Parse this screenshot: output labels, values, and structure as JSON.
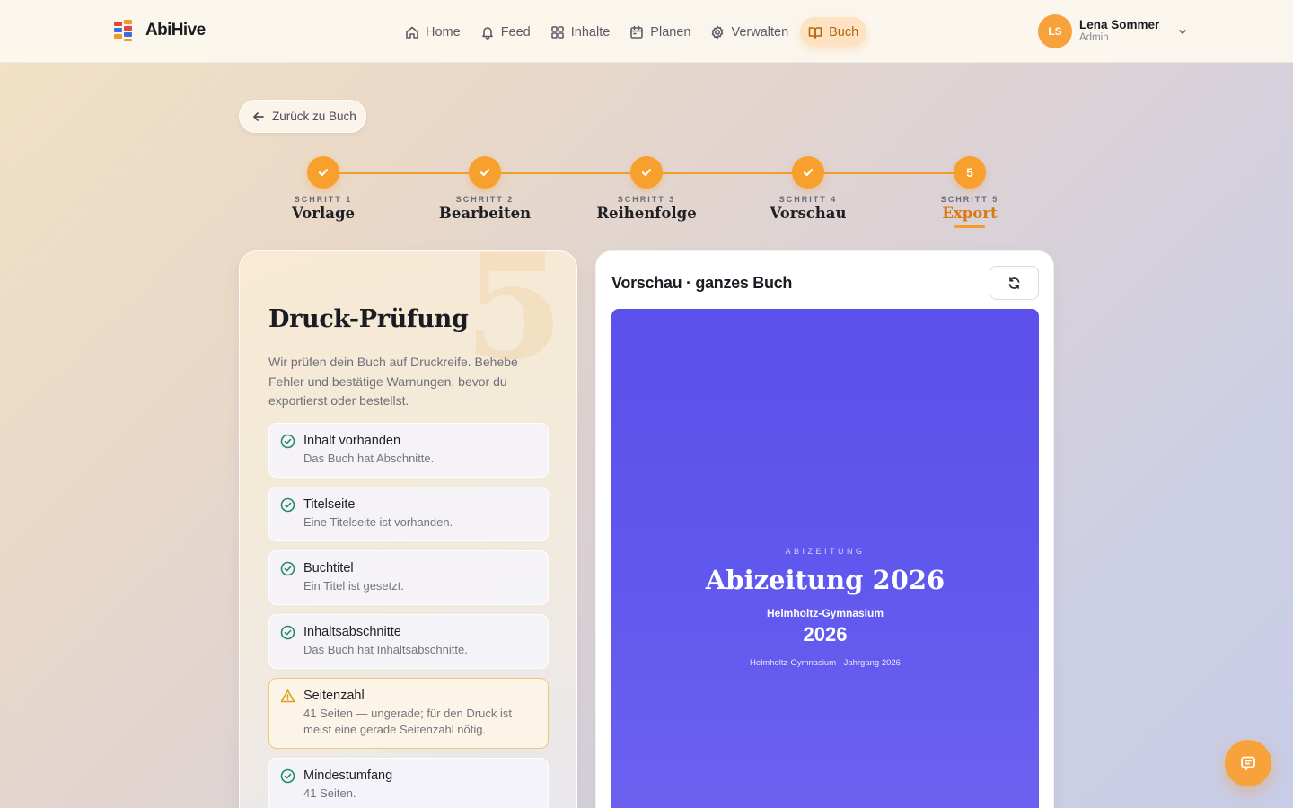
{
  "app": {
    "name": "AbiHive",
    "logo_icon": "abihive-logo-icon"
  },
  "nav": {
    "items": [
      {
        "label": "Home",
        "icon": "home-icon",
        "active": false
      },
      {
        "label": "Feed",
        "icon": "bell-icon",
        "active": false
      },
      {
        "label": "Inhalte",
        "icon": "grid-icon",
        "active": false
      },
      {
        "label": "Planen",
        "icon": "calendar-icon",
        "active": false
      },
      {
        "label": "Verwalten",
        "icon": "gear-icon",
        "active": false
      },
      {
        "label": "Buch",
        "icon": "book-icon",
        "active": true
      }
    ]
  },
  "user": {
    "initials": "LS",
    "name": "Lena Sommer",
    "role": "Admin"
  },
  "back_button": {
    "label": "Zurück zu Buch"
  },
  "stepper": {
    "steps": [
      {
        "kicker": "SCHRITT 1",
        "name": "Vorlage",
        "state": "done"
      },
      {
        "kicker": "SCHRITT 2",
        "name": "Bearbeiten",
        "state": "done"
      },
      {
        "kicker": "SCHRITT 3",
        "name": "Reihenfolge",
        "state": "done"
      },
      {
        "kicker": "SCHRITT 4",
        "name": "Vorschau",
        "state": "done"
      },
      {
        "kicker": "SCHRITT 5",
        "name": "Export",
        "number": "5",
        "state": "current"
      }
    ]
  },
  "check_panel": {
    "background_number": "5",
    "title": "Druck-Prüfung",
    "intro": "Wir prüfen dein Buch auf Druckreife. Behebe Fehler und bestätige Warnungen, bevor du exportierst oder bestellst.",
    "checks": [
      {
        "title": "Inhalt vorhanden",
        "description": "Das Buch hat Abschnitte.",
        "status": "ok"
      },
      {
        "title": "Titelseite",
        "description": "Eine Titelseite ist vorhanden.",
        "status": "ok"
      },
      {
        "title": "Buchtitel",
        "description": "Ein Titel ist gesetzt.",
        "status": "ok"
      },
      {
        "title": "Inhaltsabschnitte",
        "description": "Das Buch hat Inhaltsabschnitte.",
        "status": "ok"
      },
      {
        "title": "Seitenzahl",
        "description": "41 Seiten — ungerade; für den Druck ist meist eine gerade Seitenzahl nötig.",
        "status": "warning"
      },
      {
        "title": "Mindestumfang",
        "description": "41 Seiten.",
        "status": "ok"
      }
    ]
  },
  "preview": {
    "title": "Vorschau · ganzes Buch",
    "refresh_icon": "refresh-icon",
    "cover": {
      "kicker": "ABIZEITUNG",
      "title": "Abizeitung 2026",
      "school": "Helmholtz-Gymnasium",
      "year": "2026",
      "footer": "Helmholtz-Gymnasium · Jahrgang 2026"
    }
  },
  "colors": {
    "accent": "#f7a02e",
    "cover": "#5b50ea",
    "ok": "#1f8a6e",
    "warning": "#d9a21c"
  },
  "chat_button": {
    "icon": "chat-icon"
  }
}
